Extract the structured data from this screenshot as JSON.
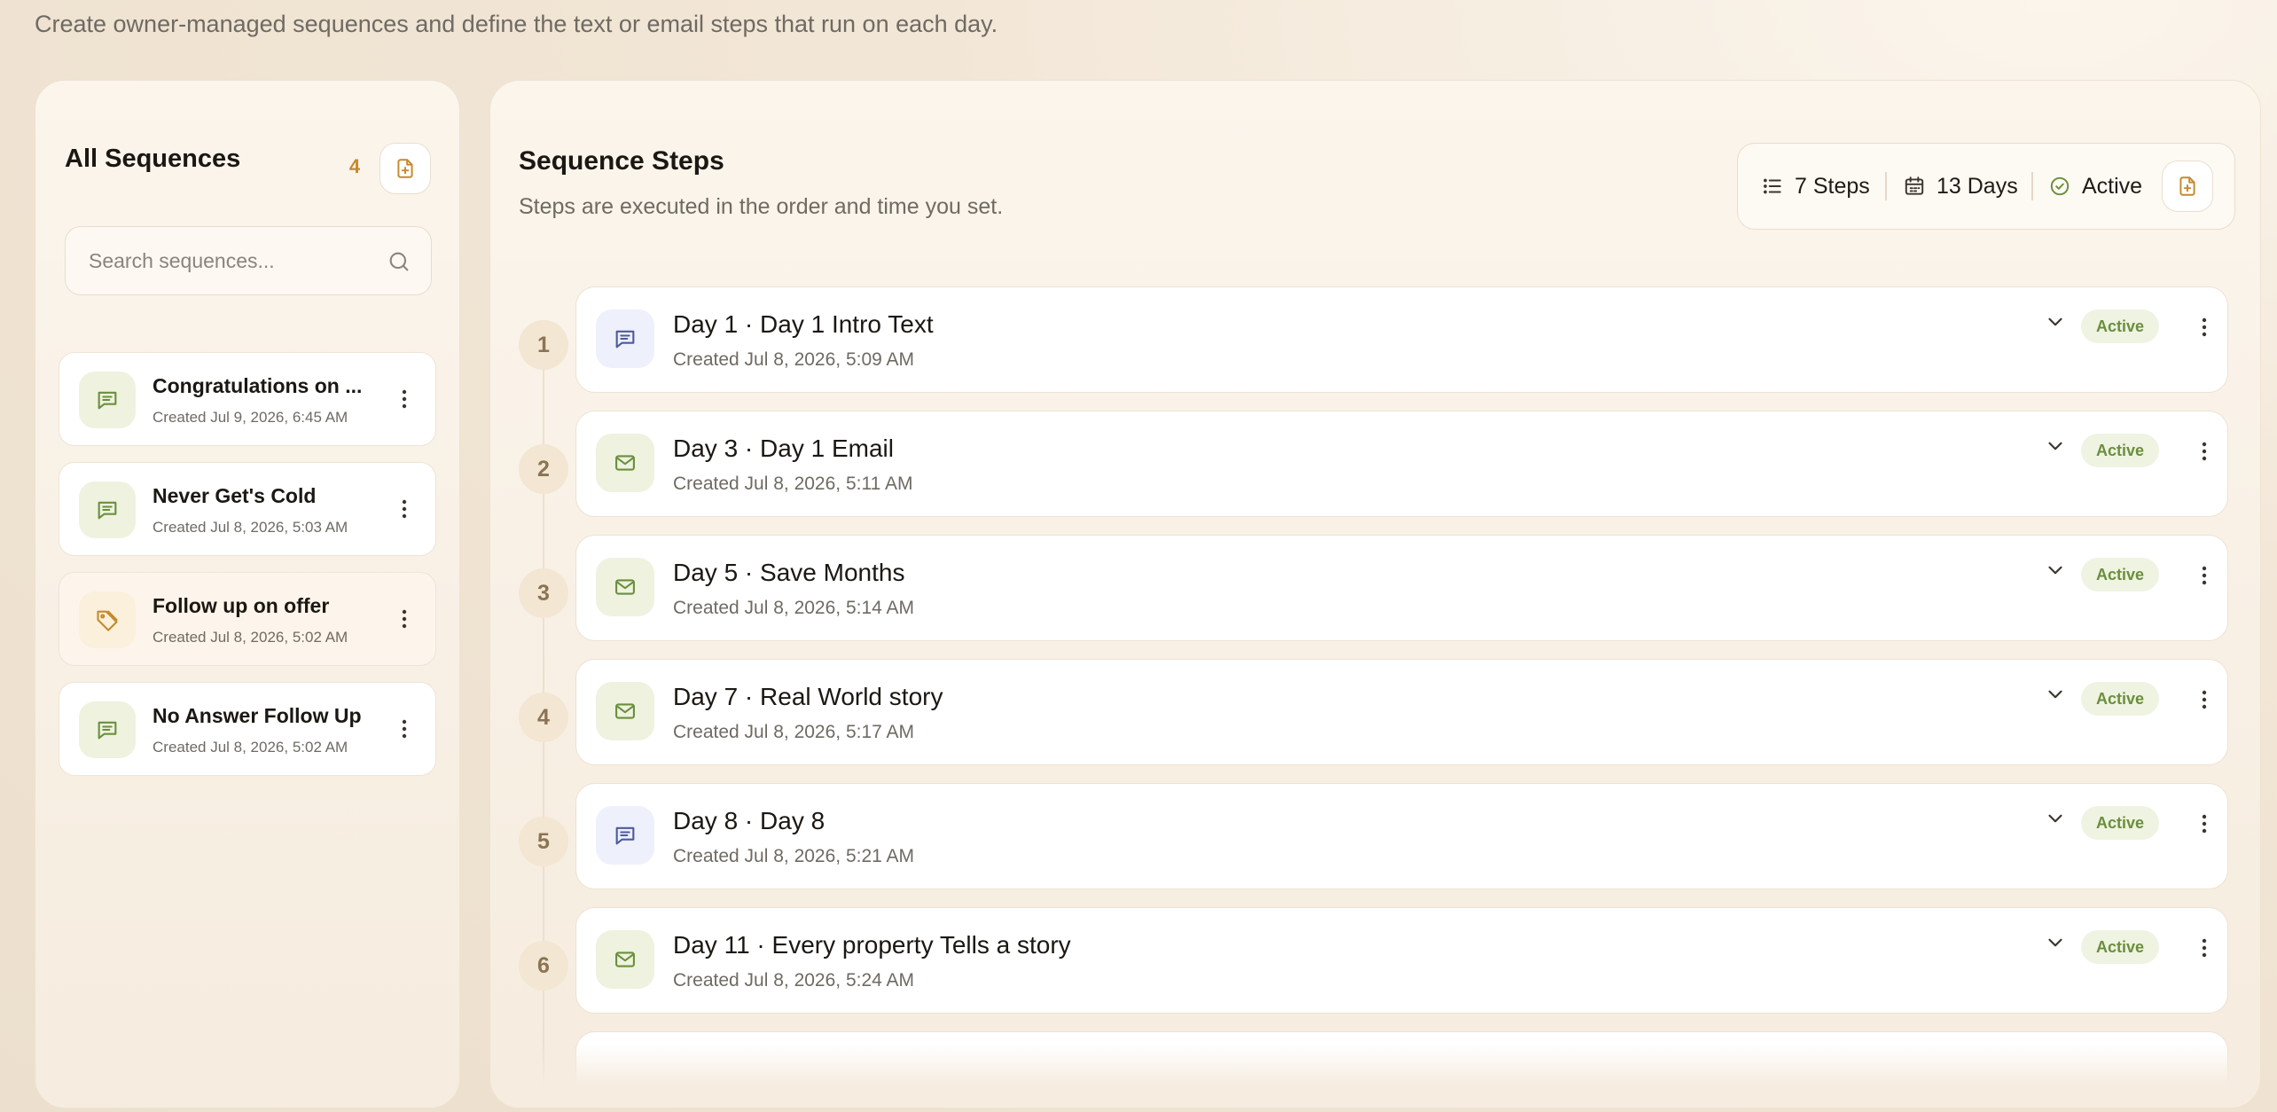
{
  "page": {
    "subtitle": "Create owner-managed sequences and define the text or email steps that run on each day."
  },
  "sidebar": {
    "title": "All Sequences",
    "count": "4",
    "search_placeholder": "Search sequences...",
    "items": [
      {
        "name": "Congratulations on ...",
        "date": "Created Jul 9, 2026, 6:45 AM",
        "icon": "message-icon",
        "selected": false
      },
      {
        "name": "Never Get's Cold",
        "date": "Created Jul 8, 2026, 5:03 AM",
        "icon": "message-icon",
        "selected": false
      },
      {
        "name": "Follow up on offer",
        "date": "Created Jul 8, 2026, 5:02 AM",
        "icon": "tag-icon",
        "selected": true
      },
      {
        "name": "No Answer Follow Up",
        "date": "Created Jul 8, 2026, 5:02 AM",
        "icon": "message-icon",
        "selected": false
      }
    ]
  },
  "main": {
    "title": "Sequence Steps",
    "subtitle": "Steps are executed in the order and time you set.",
    "stats": {
      "steps": "7 Steps",
      "days": "13 Days",
      "status": "Active"
    },
    "steps": [
      {
        "num": "1",
        "title": "Day 1 · Day 1 Intro Text",
        "date": "Created Jul 8, 2026, 5:09 AM",
        "type": "text",
        "status": "Active"
      },
      {
        "num": "2",
        "title": "Day 3 · Day 1 Email",
        "date": "Created Jul 8, 2026, 5:11 AM",
        "type": "email",
        "status": "Active"
      },
      {
        "num": "3",
        "title": "Day 5 · Save Months",
        "date": "Created Jul 8, 2026, 5:14 AM",
        "type": "email",
        "status": "Active"
      },
      {
        "num": "4",
        "title": "Day 7 · Real World story",
        "date": "Created Jul 8, 2026, 5:17 AM",
        "type": "email",
        "status": "Active"
      },
      {
        "num": "5",
        "title": "Day 8 · Day 8",
        "date": "Created Jul 8, 2026, 5:21 AM",
        "type": "text",
        "status": "Active"
      },
      {
        "num": "6",
        "title": "Day 11 · Every property Tells a story",
        "date": "Created Jul 8, 2026, 5:24 AM",
        "type": "email",
        "status": "Active"
      }
    ]
  },
  "colors": {
    "accent": "#c48a2c",
    "green_icon": "#6a8f3c",
    "blue_icon": "#4b5b9e",
    "badge_bg": "#eff3e2"
  }
}
